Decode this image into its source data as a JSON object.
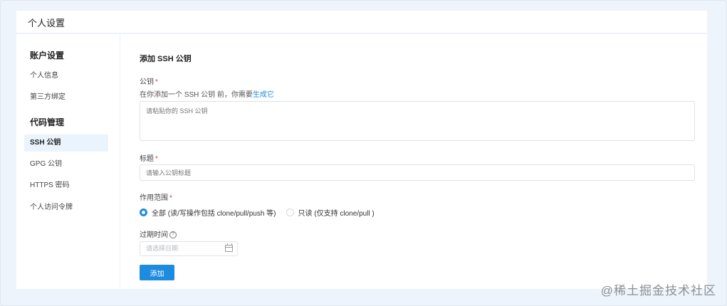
{
  "header": {
    "title": "个人设置"
  },
  "sidebar": {
    "groups": [
      {
        "heading": "账户设置",
        "items": [
          {
            "label": "个人信息"
          },
          {
            "label": "第三方绑定"
          }
        ]
      },
      {
        "heading": "代码管理",
        "items": [
          {
            "label": "SSH 公钥",
            "active": true
          },
          {
            "label": "GPG 公钥"
          },
          {
            "label": "HTTPS 密码"
          },
          {
            "label": "个人访问令牌"
          }
        ]
      }
    ]
  },
  "form": {
    "section_title": "添加 SSH 公钥",
    "public_key": {
      "label": "公钥",
      "required_mark": "*",
      "hint_prefix": "在你添加一个 SSH 公钥 前，你需要",
      "hint_link": "生成它",
      "placeholder": "请粘贴你的 SSH 公钥"
    },
    "title_field": {
      "label": "标题",
      "required_mark": "*",
      "placeholder": "请输入公钥标题"
    },
    "scope": {
      "label": "作用范围",
      "required_mark": "*",
      "options": [
        {
          "label": "全部 (读/写操作包括 clone/pull/push 等)",
          "checked": true
        },
        {
          "label": "只读 (仅支持 clone/pull )",
          "checked": false
        }
      ]
    },
    "expiry": {
      "label": "过期时间",
      "help_icon": "?",
      "placeholder": "请选择日期"
    },
    "submit_label": "添加"
  },
  "watermark": "@稀土掘金技术社区",
  "colors": {
    "accent": "#1d8ce0",
    "required": "#e0403b",
    "active_bg": "#eaf4fc"
  }
}
